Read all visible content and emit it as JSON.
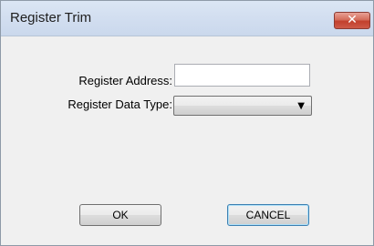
{
  "window": {
    "title": "Register Trim",
    "close_symbol": "✕",
    "close_icon": "close-icon"
  },
  "form": {
    "address_label": "Register Address:",
    "address_value": "",
    "datatype_label": "Register Data Type:",
    "datatype_selected": "",
    "dropdown_icon": "chevron-down-icon"
  },
  "buttons": {
    "ok_label": "OK",
    "cancel_label": "CANCEL"
  },
  "colors": {
    "titlebar": "#d2def0",
    "close_button": "#c94f3d",
    "dialog_background": "#f0f0f0",
    "default_button_border": "#3c7fb1"
  }
}
